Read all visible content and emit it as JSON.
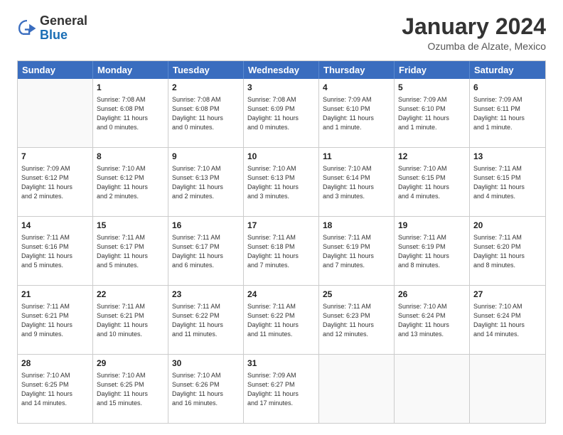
{
  "header": {
    "logo_general": "General",
    "logo_blue": "Blue",
    "month_title": "January 2024",
    "location": "Ozumba de Alzate, Mexico"
  },
  "days": [
    "Sunday",
    "Monday",
    "Tuesday",
    "Wednesday",
    "Thursday",
    "Friday",
    "Saturday"
  ],
  "weeks": [
    [
      {
        "day": "",
        "lines": []
      },
      {
        "day": "1",
        "lines": [
          "Sunrise: 7:08 AM",
          "Sunset: 6:08 PM",
          "Daylight: 11 hours",
          "and 0 minutes."
        ]
      },
      {
        "day": "2",
        "lines": [
          "Sunrise: 7:08 AM",
          "Sunset: 6:08 PM",
          "Daylight: 11 hours",
          "and 0 minutes."
        ]
      },
      {
        "day": "3",
        "lines": [
          "Sunrise: 7:08 AM",
          "Sunset: 6:09 PM",
          "Daylight: 11 hours",
          "and 0 minutes."
        ]
      },
      {
        "day": "4",
        "lines": [
          "Sunrise: 7:09 AM",
          "Sunset: 6:10 PM",
          "Daylight: 11 hours",
          "and 1 minute."
        ]
      },
      {
        "day": "5",
        "lines": [
          "Sunrise: 7:09 AM",
          "Sunset: 6:10 PM",
          "Daylight: 11 hours",
          "and 1 minute."
        ]
      },
      {
        "day": "6",
        "lines": [
          "Sunrise: 7:09 AM",
          "Sunset: 6:11 PM",
          "Daylight: 11 hours",
          "and 1 minute."
        ]
      }
    ],
    [
      {
        "day": "7",
        "lines": [
          "Sunrise: 7:09 AM",
          "Sunset: 6:12 PM",
          "Daylight: 11 hours",
          "and 2 minutes."
        ]
      },
      {
        "day": "8",
        "lines": [
          "Sunrise: 7:10 AM",
          "Sunset: 6:12 PM",
          "Daylight: 11 hours",
          "and 2 minutes."
        ]
      },
      {
        "day": "9",
        "lines": [
          "Sunrise: 7:10 AM",
          "Sunset: 6:13 PM",
          "Daylight: 11 hours",
          "and 2 minutes."
        ]
      },
      {
        "day": "10",
        "lines": [
          "Sunrise: 7:10 AM",
          "Sunset: 6:13 PM",
          "Daylight: 11 hours",
          "and 3 minutes."
        ]
      },
      {
        "day": "11",
        "lines": [
          "Sunrise: 7:10 AM",
          "Sunset: 6:14 PM",
          "Daylight: 11 hours",
          "and 3 minutes."
        ]
      },
      {
        "day": "12",
        "lines": [
          "Sunrise: 7:10 AM",
          "Sunset: 6:15 PM",
          "Daylight: 11 hours",
          "and 4 minutes."
        ]
      },
      {
        "day": "13",
        "lines": [
          "Sunrise: 7:11 AM",
          "Sunset: 6:15 PM",
          "Daylight: 11 hours",
          "and 4 minutes."
        ]
      }
    ],
    [
      {
        "day": "14",
        "lines": [
          "Sunrise: 7:11 AM",
          "Sunset: 6:16 PM",
          "Daylight: 11 hours",
          "and 5 minutes."
        ]
      },
      {
        "day": "15",
        "lines": [
          "Sunrise: 7:11 AM",
          "Sunset: 6:17 PM",
          "Daylight: 11 hours",
          "and 5 minutes."
        ]
      },
      {
        "day": "16",
        "lines": [
          "Sunrise: 7:11 AM",
          "Sunset: 6:17 PM",
          "Daylight: 11 hours",
          "and 6 minutes."
        ]
      },
      {
        "day": "17",
        "lines": [
          "Sunrise: 7:11 AM",
          "Sunset: 6:18 PM",
          "Daylight: 11 hours",
          "and 7 minutes."
        ]
      },
      {
        "day": "18",
        "lines": [
          "Sunrise: 7:11 AM",
          "Sunset: 6:19 PM",
          "Daylight: 11 hours",
          "and 7 minutes."
        ]
      },
      {
        "day": "19",
        "lines": [
          "Sunrise: 7:11 AM",
          "Sunset: 6:19 PM",
          "Daylight: 11 hours",
          "and 8 minutes."
        ]
      },
      {
        "day": "20",
        "lines": [
          "Sunrise: 7:11 AM",
          "Sunset: 6:20 PM",
          "Daylight: 11 hours",
          "and 8 minutes."
        ]
      }
    ],
    [
      {
        "day": "21",
        "lines": [
          "Sunrise: 7:11 AM",
          "Sunset: 6:21 PM",
          "Daylight: 11 hours",
          "and 9 minutes."
        ]
      },
      {
        "day": "22",
        "lines": [
          "Sunrise: 7:11 AM",
          "Sunset: 6:21 PM",
          "Daylight: 11 hours",
          "and 10 minutes."
        ]
      },
      {
        "day": "23",
        "lines": [
          "Sunrise: 7:11 AM",
          "Sunset: 6:22 PM",
          "Daylight: 11 hours",
          "and 11 minutes."
        ]
      },
      {
        "day": "24",
        "lines": [
          "Sunrise: 7:11 AM",
          "Sunset: 6:22 PM",
          "Daylight: 11 hours",
          "and 11 minutes."
        ]
      },
      {
        "day": "25",
        "lines": [
          "Sunrise: 7:11 AM",
          "Sunset: 6:23 PM",
          "Daylight: 11 hours",
          "and 12 minutes."
        ]
      },
      {
        "day": "26",
        "lines": [
          "Sunrise: 7:10 AM",
          "Sunset: 6:24 PM",
          "Daylight: 11 hours",
          "and 13 minutes."
        ]
      },
      {
        "day": "27",
        "lines": [
          "Sunrise: 7:10 AM",
          "Sunset: 6:24 PM",
          "Daylight: 11 hours",
          "and 14 minutes."
        ]
      }
    ],
    [
      {
        "day": "28",
        "lines": [
          "Sunrise: 7:10 AM",
          "Sunset: 6:25 PM",
          "Daylight: 11 hours",
          "and 14 minutes."
        ]
      },
      {
        "day": "29",
        "lines": [
          "Sunrise: 7:10 AM",
          "Sunset: 6:25 PM",
          "Daylight: 11 hours",
          "and 15 minutes."
        ]
      },
      {
        "day": "30",
        "lines": [
          "Sunrise: 7:10 AM",
          "Sunset: 6:26 PM",
          "Daylight: 11 hours",
          "and 16 minutes."
        ]
      },
      {
        "day": "31",
        "lines": [
          "Sunrise: 7:09 AM",
          "Sunset: 6:27 PM",
          "Daylight: 11 hours",
          "and 17 minutes."
        ]
      },
      {
        "day": "",
        "lines": []
      },
      {
        "day": "",
        "lines": []
      },
      {
        "day": "",
        "lines": []
      }
    ]
  ]
}
